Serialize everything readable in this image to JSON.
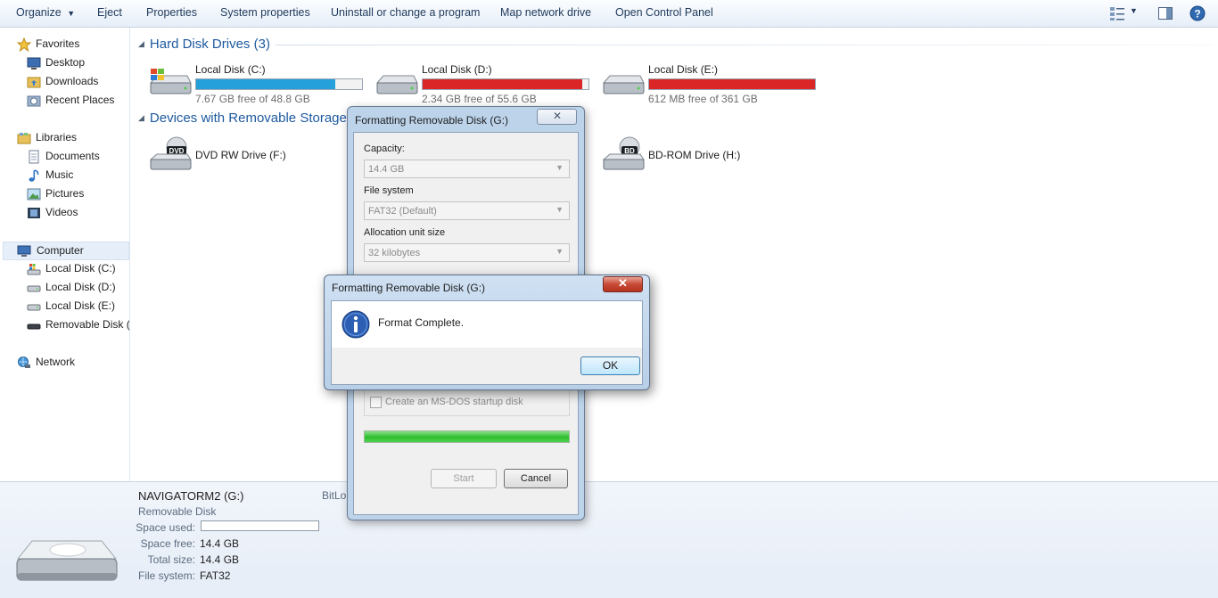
{
  "toolbar": {
    "organize": "Organize",
    "eject": "Eject",
    "properties": "Properties",
    "system_properties": "System properties",
    "uninstall": "Uninstall or change a program",
    "map_drive": "Map network drive",
    "control_panel": "Open Control Panel"
  },
  "sidebar": {
    "favorites": "Favorites",
    "desktop": "Desktop",
    "downloads": "Downloads",
    "recent": "Recent Places",
    "libraries": "Libraries",
    "documents": "Documents",
    "music": "Music",
    "pictures": "Pictures",
    "videos": "Videos",
    "computer": "Computer",
    "disk_c": "Local Disk (C:)",
    "disk_d": "Local Disk (D:)",
    "disk_e": "Local Disk (E:)",
    "removable": "Removable Disk (",
    "network": "Network"
  },
  "content": {
    "hard_disk_header": "Hard Disk Drives (3)",
    "removable_header": "Devices with Removable Storage",
    "drives": [
      {
        "name": "Local Disk (C:)",
        "free": "7.67 GB free of 48.8 GB",
        "used_fraction": 0.84,
        "color": "#26a0da"
      },
      {
        "name": "Local Disk (D:)",
        "free": "2.34 GB free of 55.6 GB",
        "used_fraction": 0.96,
        "color": "#da2626"
      },
      {
        "name": "Local Disk (E:)",
        "free": "612 MB free of 361 GB",
        "used_fraction": 0.998,
        "color": "#da2626"
      }
    ],
    "dvd": "DVD RW Drive (F:)",
    "bd": "BD-ROM Drive (H:)"
  },
  "details": {
    "name": "NAVIGATORM2 (G:)",
    "type": "Removable Disk",
    "bitlocker": "BitLo",
    "space_used_label": "Space used:",
    "space_free_label": "Space free:",
    "space_free": "14.4 GB",
    "total_size_label": "Total size:",
    "total_size": "14.4 GB",
    "file_system_label": "File system:",
    "file_system": "FAT32"
  },
  "format_dialog": {
    "title": "Formatting Removable Disk (G:)",
    "capacity_label": "Capacity:",
    "capacity": "14.4 GB",
    "fs_label": "File system",
    "fs": "FAT32 (Default)",
    "alloc_label": "Allocation unit size",
    "alloc": "32 kilobytes",
    "msdos_label": "Create an MS-DOS startup disk",
    "progress": 1.0,
    "start": "Start",
    "cancel": "Cancel"
  },
  "message_box": {
    "title": "Formatting Removable Disk (G:)",
    "message": "Format Complete.",
    "ok": "OK"
  }
}
